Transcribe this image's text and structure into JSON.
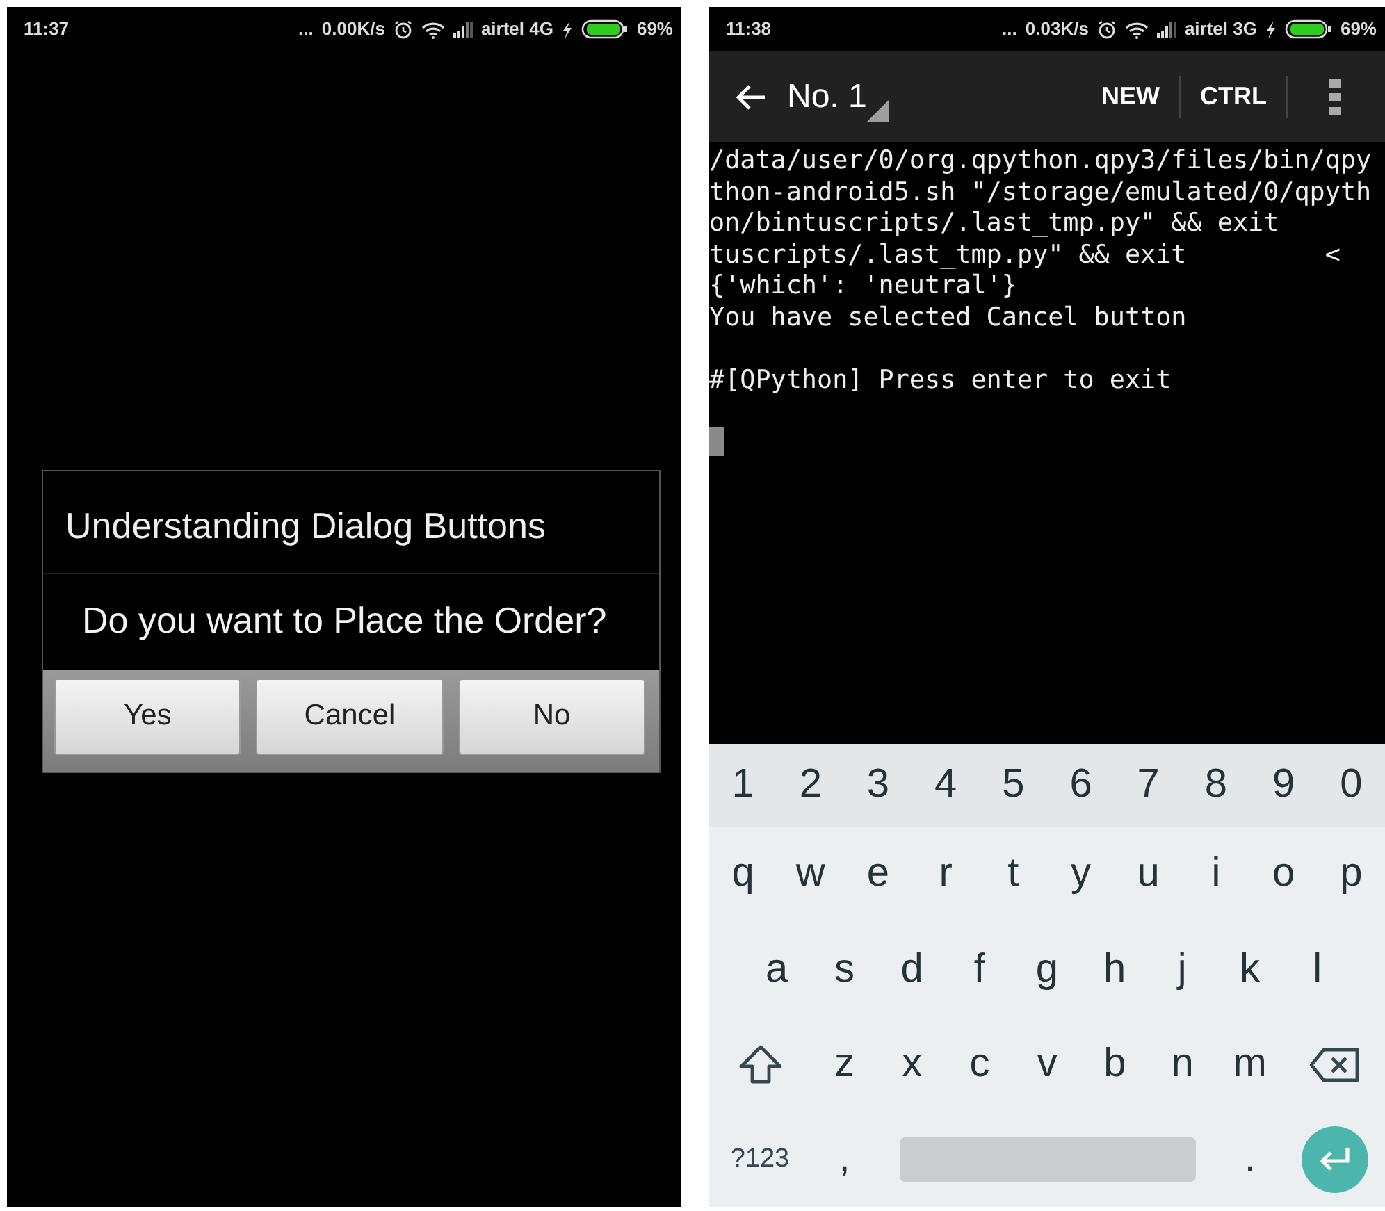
{
  "left_screen": {
    "status_bar": {
      "time": "11:37",
      "dots": "...",
      "speed": "0.00K/s",
      "network": "airtel 4G",
      "battery": "69%"
    },
    "dialog": {
      "title": "Understanding Dialog Buttons",
      "message": "Do you want to Place the Order?",
      "buttons": [
        "Yes",
        "Cancel",
        "No"
      ]
    }
  },
  "right_screen": {
    "status_bar": {
      "time": "11:38",
      "dots": "...",
      "speed": "0.03K/s",
      "network": "airtel 3G",
      "battery": "69%"
    },
    "toolbar": {
      "title": "No. 1",
      "actions": [
        "NEW",
        "CTRL"
      ]
    },
    "terminal": {
      "output": [
        "/data/user/0/org.qpython.qpy3/files/bin/qpy",
        "thon-android5.sh \"/storage/emulated/0/qpyth",
        "on/bintuscripts/.last_tmp.py\" && exit",
        "tuscripts/.last_tmp.py\" && exit         <",
        "{'which': 'neutral'}",
        "You have selected Cancel button"
      ],
      "prompt": "#[QPython] Press enter to exit"
    },
    "keyboard": {
      "rows": [
        [
          {
            "kind": "char",
            "label": "1"
          },
          {
            "kind": "char",
            "label": "2"
          },
          {
            "kind": "char",
            "label": "3"
          },
          {
            "kind": "char",
            "label": "4"
          },
          {
            "kind": "char",
            "label": "5"
          },
          {
            "kind": "char",
            "label": "6"
          },
          {
            "kind": "char",
            "label": "7"
          },
          {
            "kind": "char",
            "label": "8"
          },
          {
            "kind": "char",
            "label": "9"
          },
          {
            "kind": "char",
            "label": "0"
          }
        ],
        [
          {
            "kind": "char",
            "label": "q"
          },
          {
            "kind": "char",
            "label": "w"
          },
          {
            "kind": "char",
            "label": "e"
          },
          {
            "kind": "char",
            "label": "r"
          },
          {
            "kind": "char",
            "label": "t"
          },
          {
            "kind": "char",
            "label": "y"
          },
          {
            "kind": "char",
            "label": "u"
          },
          {
            "kind": "char",
            "label": "i"
          },
          {
            "kind": "char",
            "label": "o"
          },
          {
            "kind": "char",
            "label": "p"
          }
        ],
        [
          {
            "kind": "char",
            "label": "a"
          },
          {
            "kind": "char",
            "label": "s"
          },
          {
            "kind": "char",
            "label": "d"
          },
          {
            "kind": "char",
            "label": "f"
          },
          {
            "kind": "char",
            "label": "g"
          },
          {
            "kind": "char",
            "label": "h"
          },
          {
            "kind": "char",
            "label": "j"
          },
          {
            "kind": "char",
            "label": "k"
          },
          {
            "kind": "char",
            "label": "l"
          }
        ],
        [
          {
            "kind": "shift"
          },
          {
            "kind": "char",
            "label": "z"
          },
          {
            "kind": "char",
            "label": "x"
          },
          {
            "kind": "char",
            "label": "c"
          },
          {
            "kind": "char",
            "label": "v"
          },
          {
            "kind": "char",
            "label": "b"
          },
          {
            "kind": "char",
            "label": "n"
          },
          {
            "kind": "char",
            "label": "m"
          },
          {
            "kind": "backspace"
          }
        ],
        [
          {
            "kind": "mode",
            "label": "?123"
          },
          {
            "kind": "char",
            "label": ","
          },
          {
            "kind": "space"
          },
          {
            "kind": "char",
            "label": "."
          },
          {
            "kind": "enter"
          }
        ]
      ]
    }
  }
}
